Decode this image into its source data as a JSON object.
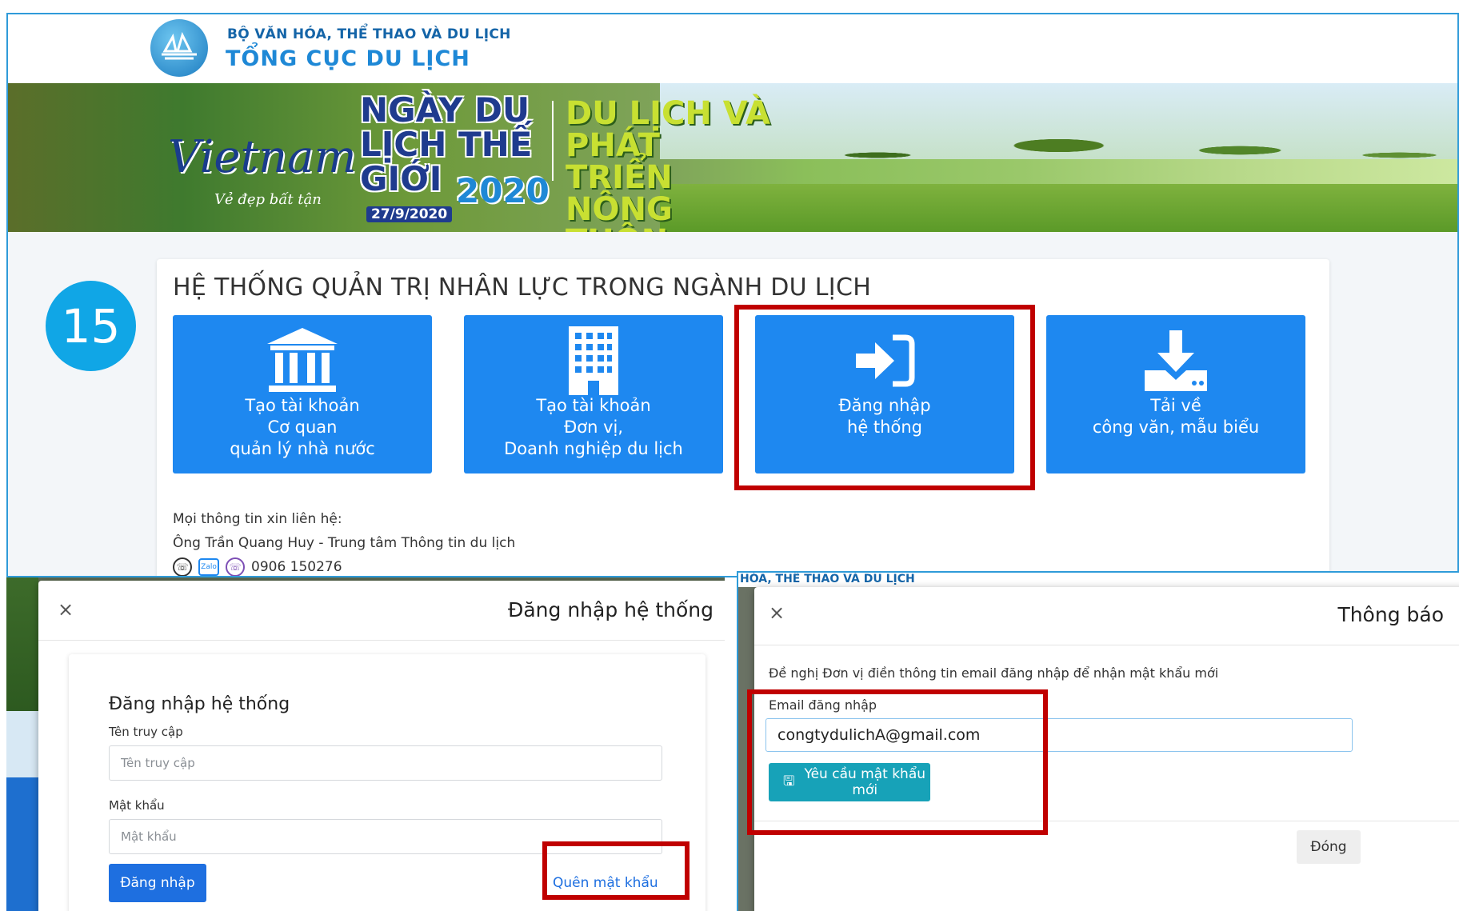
{
  "header": {
    "ministry": "BỘ VĂN HÓA, THỂ THAO VÀ DU LỊCH",
    "department": "TỔNG CỤC DU LỊCH"
  },
  "banner": {
    "brand": "Vietnam",
    "tagline": "Vẻ đẹp bất tận",
    "event_title": "NGÀY DU LỊCH THẾ GIỚI",
    "year": "2020",
    "date": "27/9/2020",
    "theme": "DU LỊCH VÀ PHÁT TRIỂN NÔNG THÔN"
  },
  "step_number": "15",
  "system_title": "HỆ THỐNG QUẢN TRỊ NHÂN LỰC TRONG NGÀNH DU LỊCH",
  "tiles": [
    {
      "icon": "bank-building-icon",
      "lines": [
        "Tạo tài khoản",
        "Cơ quan",
        "quản lý nhà nước"
      ]
    },
    {
      "icon": "office-building-icon",
      "lines": [
        "Tạo tài khoản",
        "Đơn vị,",
        "Doanh nghiệp du lịch"
      ]
    },
    {
      "icon": "sign-in-icon",
      "lines": [
        "Đăng nhập",
        "hệ thống"
      ]
    },
    {
      "icon": "download-icon",
      "lines": [
        "Tải về",
        "công văn, mẫu biểu"
      ]
    }
  ],
  "contact": {
    "intro": "Mọi thông tin xin liên hệ:",
    "person": "Ông Trần Quang Huy - Trung tâm Thông tin du lịch",
    "phone": "0906 150276",
    "zalo_label": "Zalo"
  },
  "login_modal": {
    "title": "Đăng nhập hệ thống",
    "close": "×",
    "card_title": "Đăng nhập hệ thống",
    "username_label": "Tên truy cập",
    "username_placeholder": "Tên truy cập",
    "password_label": "Mật khẩu",
    "password_placeholder": "Mật khẩu",
    "submit_label": "Đăng nhập",
    "forgot_label": "Quên mật khẩu"
  },
  "notify_modal": {
    "top_strip": "HÓA, THỂ THAO VÀ DU LỊCH",
    "title": "Thông báo",
    "close": "×",
    "message": "Đề nghị Đơn vị điền thông tin email đăng nhập để nhận mật khẩu mới",
    "email_label": "Email đăng nhập",
    "email_value": "congtydulichA@gmail.com",
    "request_label": "Yêu cầu mật khẩu mới",
    "close_button": "Đóng"
  },
  "colors": {
    "tile_blue": "#1e88f0",
    "highlight_red": "#c00000",
    "badge_blue": "#10a6e6",
    "info_teal": "#17a2b8"
  }
}
